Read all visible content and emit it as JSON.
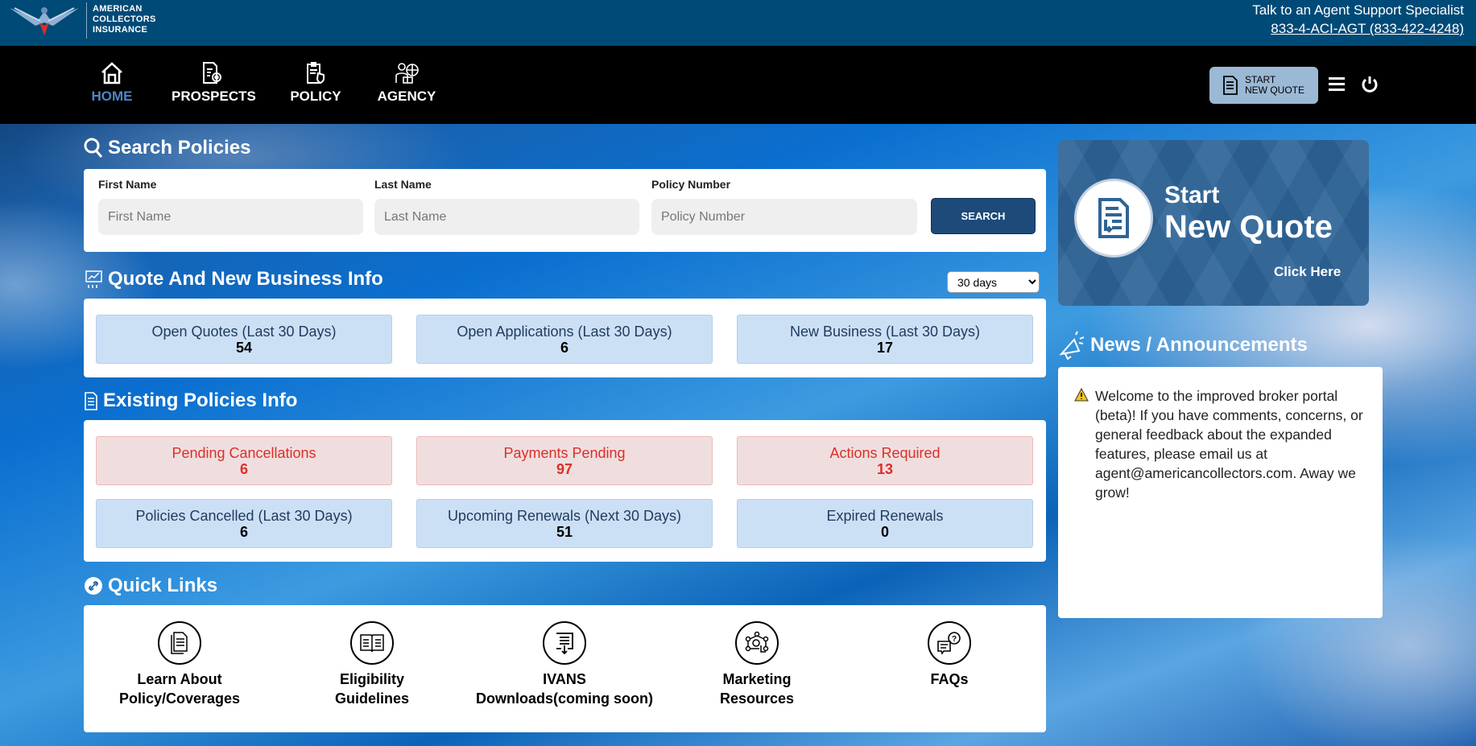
{
  "brand": {
    "logo_text": [
      "AMERICAN",
      "COLLECTORS",
      "INSURANCE"
    ],
    "colors": {
      "topbar": "#004a77",
      "nav": "#000000",
      "active": "#4d86c4",
      "card": "#2d6497"
    }
  },
  "support": {
    "line1": "Talk to an Agent Support Specialist",
    "phone": "833-4-ACI-AGT (833-422-4248)"
  },
  "nav": {
    "items": [
      {
        "label": "HOME",
        "icon": "home-icon",
        "active": true
      },
      {
        "label": "PROSPECTS",
        "icon": "document-gear-icon"
      },
      {
        "label": "POLICY",
        "icon": "clipboard-shield-icon"
      },
      {
        "label": "AGENCY",
        "icon": "agent-globe-icon"
      }
    ],
    "start_quote_line1": "START",
    "start_quote_line2": "NEW QUOTE"
  },
  "search": {
    "title": "Search Policies",
    "fields": [
      {
        "label": "First Name",
        "placeholder": "First Name"
      },
      {
        "label": "Last Name",
        "placeholder": "Last Name"
      },
      {
        "label": "Policy Number",
        "placeholder": "Policy Number"
      }
    ],
    "button": "SEARCH"
  },
  "quote": {
    "title": "Quote And New Business Info",
    "range": "30 days",
    "stats": [
      {
        "label": "Open Quotes (Last 30 Days)",
        "value": "54"
      },
      {
        "label": "Open Applications (Last 30 Days)",
        "value": "6"
      },
      {
        "label": "New Business (Last 30 Days)",
        "value": "17"
      }
    ]
  },
  "existing": {
    "title": "Existing Policies Info",
    "alerts": [
      {
        "label": "Pending Cancellations",
        "value": "6"
      },
      {
        "label": "Payments Pending",
        "value": "97"
      },
      {
        "label": "Actions Required",
        "value": "13"
      }
    ],
    "stats": [
      {
        "label": "Policies Cancelled (Last 30 Days)",
        "value": "6"
      },
      {
        "label": "Upcoming Renewals (Next 30 Days)",
        "value": "51"
      },
      {
        "label": "Expired Renewals",
        "value": "0"
      }
    ]
  },
  "quicklinks": {
    "title": "Quick Links",
    "items": [
      {
        "l1": "Learn About",
        "l2": "Policy/Coverages",
        "icon": "documents-icon"
      },
      {
        "l1": "Eligibility",
        "l2": "Guidelines",
        "icon": "book-icon"
      },
      {
        "l1": "IVANS",
        "l2": "Downloads(coming soon)",
        "icon": "download-doc-icon"
      },
      {
        "l1": "Marketing",
        "l2": "Resources",
        "icon": "network-icon"
      },
      {
        "l1": "FAQs",
        "l2": "",
        "icon": "faq-bubble-icon"
      }
    ]
  },
  "newquote_card": {
    "line1": "Start",
    "line2": "New Quote",
    "cta": "Click Here"
  },
  "news": {
    "title": "News / Announcements",
    "text": "Welcome to the improved broker portal (beta)! If you have comments, concerns, or general feedback about the expanded features, please email us at agent@americancollectors.com. Away we grow!"
  }
}
